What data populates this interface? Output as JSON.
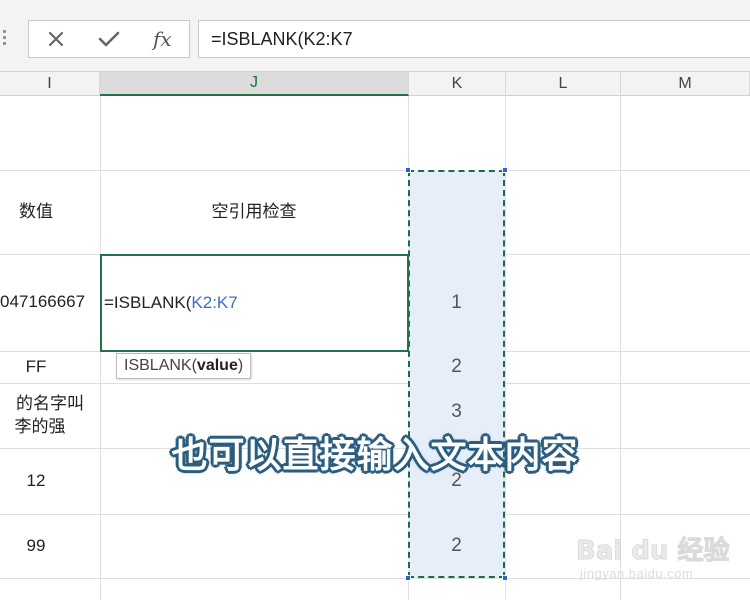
{
  "formula_bar": {
    "cancel_icon": "close-x-icon",
    "enter_icon": "checkmark-icon",
    "fx_label": "fx",
    "formula": "=ISBLANK(K2:K7"
  },
  "columns": {
    "i": "I",
    "j": "J",
    "k": "K",
    "l": "L",
    "m": "M"
  },
  "cells": {
    "i_header": "数值",
    "j_header": "空引用检查",
    "i_row_formula": "047166667",
    "i_row2": "FF",
    "i_row3_line1": "的名字叫",
    "i_row3_line2": "李的强",
    "i_row4": "12",
    "i_row5": "99"
  },
  "edit_cell": {
    "prefix": "=ISBLANK(",
    "ref": "K2:K7"
  },
  "k_values": [
    "1",
    "2",
    "3",
    "2",
    "2"
  ],
  "tooltip": {
    "func": "ISBLANK(",
    "arg": "value",
    "close": ")"
  },
  "caption": "也可以直接输入文本内容",
  "watermark": {
    "main": "Bai du 经验",
    "sub": "jingyan.baidu.com"
  },
  "colors": {
    "accent_green": "#217346",
    "reference_blue": "#3a6fc4",
    "range_fill": "#e6eef9"
  }
}
